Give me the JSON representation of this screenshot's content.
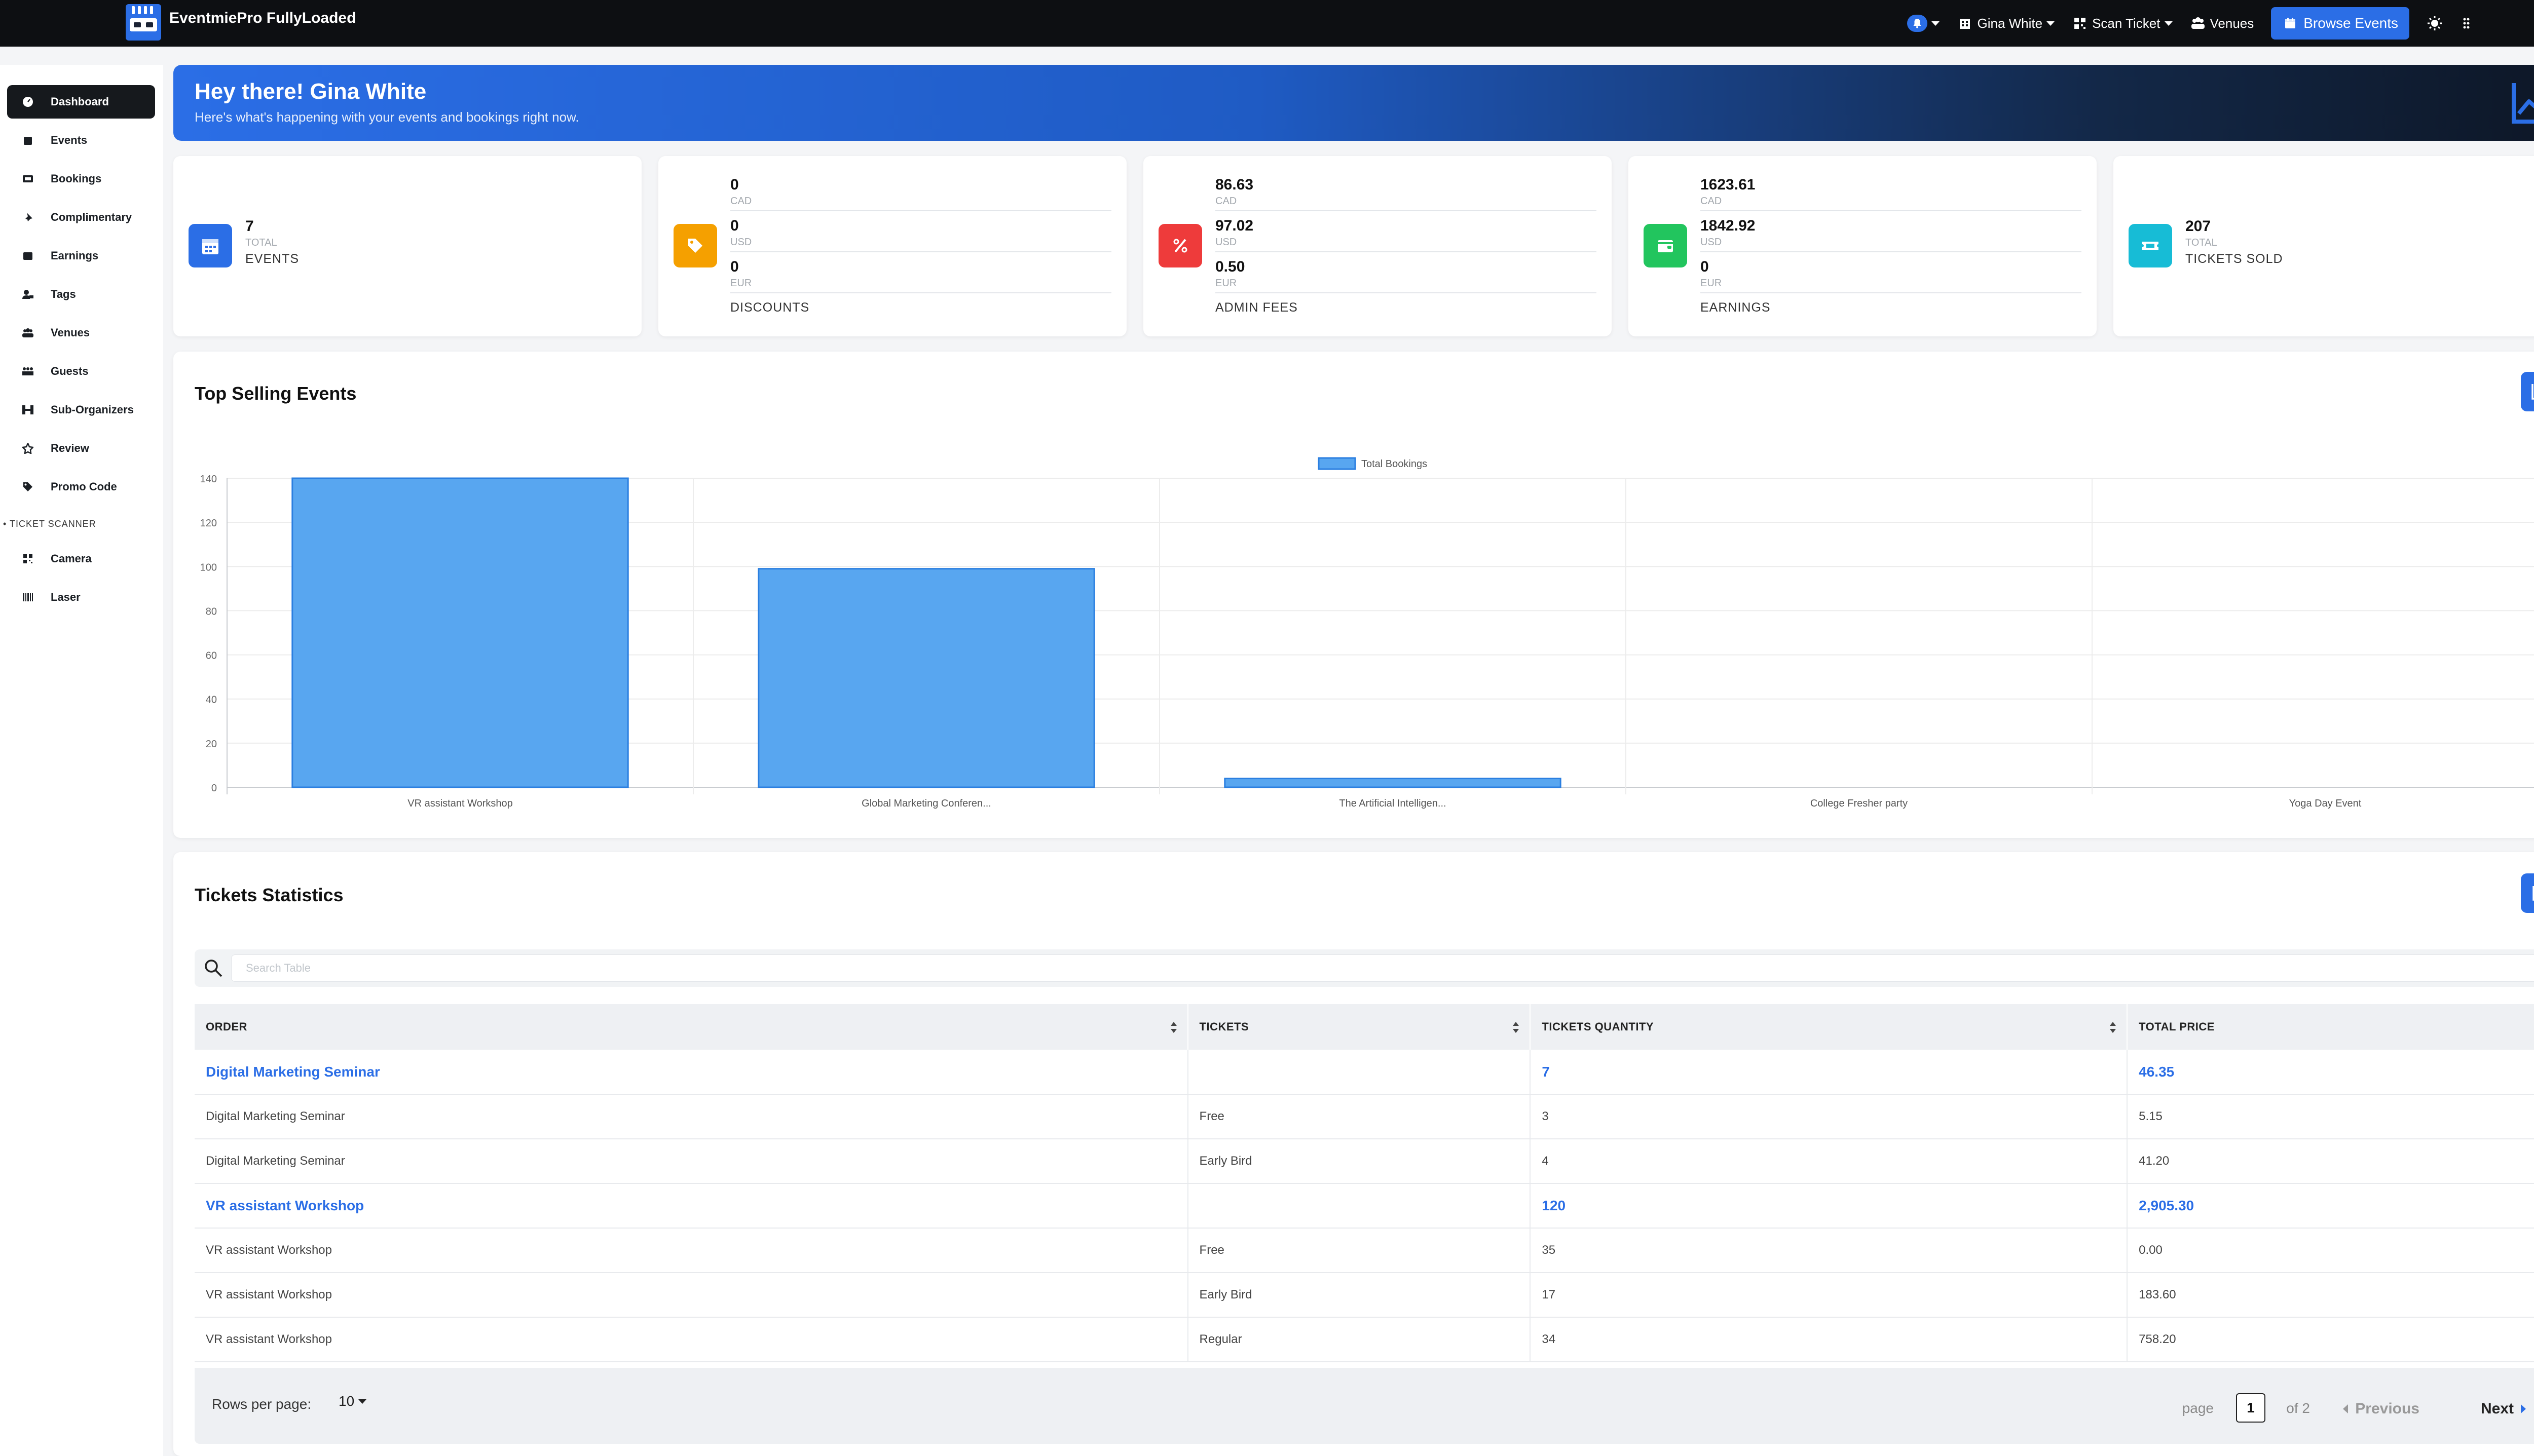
{
  "app": {
    "name": "EventmiePro FullyLoaded"
  },
  "topnav": {
    "user": "Gina White",
    "scan": "Scan Ticket",
    "venues": "Venues",
    "browse": "Browse Events"
  },
  "sidebar": {
    "items": [
      {
        "label": "Dashboard",
        "icon": "gauge-icon"
      },
      {
        "label": "Events",
        "icon": "calendar-icon"
      },
      {
        "label": "Bookings",
        "icon": "ticket-icon"
      },
      {
        "label": "Complimentary",
        "icon": "pin-icon"
      },
      {
        "label": "Earnings",
        "icon": "wallet-icon"
      },
      {
        "label": "Tags",
        "icon": "user-tag-icon"
      },
      {
        "label": "Venues",
        "icon": "venue-icon"
      },
      {
        "label": "Guests",
        "icon": "guests-icon"
      },
      {
        "label": "Sub-Organizers",
        "icon": "sitemap-icon"
      },
      {
        "label": "Review",
        "icon": "star-icon"
      },
      {
        "label": "Promo Code",
        "icon": "tag-icon"
      }
    ],
    "scanner_section": "TICKET SCANNER",
    "scanner_items": [
      {
        "label": "Camera",
        "icon": "qrcode-icon"
      },
      {
        "label": "Laser",
        "icon": "barcode-icon"
      }
    ]
  },
  "hero": {
    "title": "Hey there! Gina White",
    "subtitle": "Here's what's happening with your events and bookings right now."
  },
  "stats": {
    "events": {
      "value": "7",
      "sub": "TOTAL",
      "title": "EVENTS",
      "color": "#2b6ee6"
    },
    "discounts": {
      "rows": [
        {
          "v": "0",
          "c": "CAD"
        },
        {
          "v": "0",
          "c": "USD"
        },
        {
          "v": "0",
          "c": "EUR"
        }
      ],
      "title": "DISCOUNTS",
      "color": "#f5a000"
    },
    "admin_fees": {
      "rows": [
        {
          "v": "86.63",
          "c": "CAD"
        },
        {
          "v": "97.02",
          "c": "USD"
        },
        {
          "v": "0.50",
          "c": "EUR"
        }
      ],
      "title": "ADMIN FEES",
      "color": "#ee3b3b"
    },
    "earnings": {
      "rows": [
        {
          "v": "1623.61",
          "c": "CAD"
        },
        {
          "v": "1842.92",
          "c": "USD"
        },
        {
          "v": "0",
          "c": "EUR"
        }
      ],
      "title": "EARNINGS",
      "color": "#22c55e"
    },
    "tickets": {
      "value": "207",
      "sub": "TOTAL",
      "title": "TICKETS SOLD",
      "color": "#17bcd6"
    }
  },
  "top_selling": {
    "title": "Top Selling Events"
  },
  "chart_data": {
    "type": "bar",
    "categories": [
      "VR assistant Workshop",
      "Global Marketing Conferen...",
      "The Artificial Intelligen...",
      "College Fresher party",
      "Yoga Day Event"
    ],
    "series": [
      {
        "name": "Total Bookings",
        "values": [
          140,
          99,
          4,
          0,
          0
        ]
      }
    ],
    "ylim": [
      0,
      140
    ],
    "yticks": [
      0,
      20,
      40,
      60,
      80,
      100,
      120,
      140
    ],
    "legend": "top-center",
    "grid": true,
    "colors": {
      "fill": "#58a6f0",
      "stroke": "#2b7fe0"
    }
  },
  "tickets_stats": {
    "title": "Tickets Statistics",
    "search_placeholder": "Search Table",
    "columns": [
      "ORDER",
      "TICKETS",
      "TICKETS QUANTITY",
      "TOTAL PRICE"
    ],
    "rows": [
      {
        "group": true,
        "order": "Digital Marketing Seminar",
        "ticket": "",
        "qty": "7",
        "price": "46.35"
      },
      {
        "group": false,
        "order": "Digital Marketing Seminar",
        "ticket": "Free",
        "qty": "3",
        "price": "5.15"
      },
      {
        "group": false,
        "order": "Digital Marketing Seminar",
        "ticket": "Early Bird",
        "qty": "4",
        "price": "41.20"
      },
      {
        "group": true,
        "order": "VR assistant Workshop",
        "ticket": "",
        "qty": "120",
        "price": "2,905.30"
      },
      {
        "group": false,
        "order": "VR assistant Workshop",
        "ticket": "Free",
        "qty": "35",
        "price": "0.00"
      },
      {
        "group": false,
        "order": "VR assistant Workshop",
        "ticket": "Early Bird",
        "qty": "17",
        "price": "183.60"
      },
      {
        "group": false,
        "order": "VR assistant Workshop",
        "ticket": "Regular",
        "qty": "34",
        "price": "758.20"
      }
    ],
    "pagination": {
      "rows_label": "Rows per page:",
      "rows_value": "10",
      "page_label": "page",
      "page_value": "1",
      "of_label": "of 2",
      "prev": "Previous",
      "next": "Next"
    }
  }
}
